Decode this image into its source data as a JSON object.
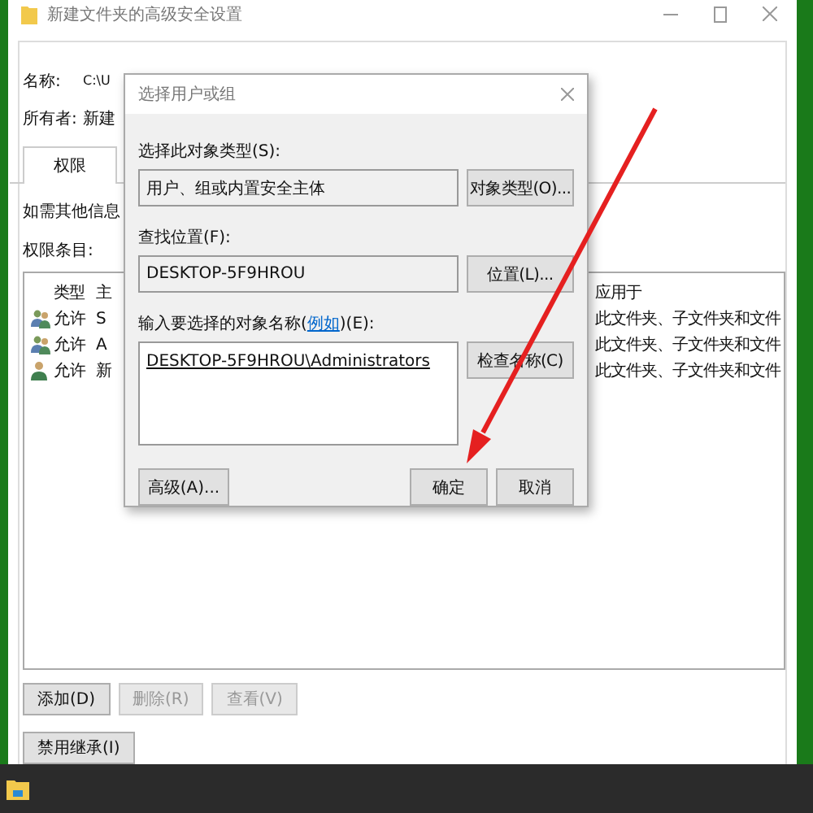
{
  "window": {
    "title": "新建文件夹的高级安全设置"
  },
  "fields": [
    {
      "label": "名称:",
      "value": "C:\\U"
    },
    {
      "label": "所有者:",
      "value": "新建"
    }
  ],
  "tabs": [
    {
      "label": "权限",
      "selected": true
    }
  ],
  "info_text": "如需其他信息",
  "entries_label": "权限条目:",
  "table": {
    "columns": [
      "类型",
      "主",
      "应用于"
    ],
    "rows": [
      {
        "kind": "group",
        "type": "允许",
        "principal": "S",
        "applies_to": "此文件夹、子文件夹和文件"
      },
      {
        "kind": "group",
        "type": "允许",
        "principal": "A",
        "applies_to": "此文件夹、子文件夹和文件"
      },
      {
        "kind": "user",
        "type": "允许",
        "principal": "新",
        "applies_to": "此文件夹、子文件夹和文件"
      }
    ]
  },
  "buttons": [
    {
      "label": "添加(D)",
      "disabled": false
    },
    {
      "label": "删除(R)",
      "disabled": true
    },
    {
      "label": "查看(V)",
      "disabled": true
    }
  ],
  "inherit_button": "禁用继承(I)",
  "dialog": {
    "title": "选择用户或组",
    "object_type": {
      "label": "选择此对象类型(S):",
      "value": "用户、组或内置安全主体",
      "button": "对象类型(O)..."
    },
    "location": {
      "label": "查找位置(F):",
      "value": "DESKTOP-5F9HROU",
      "button": "位置(L)..."
    },
    "names": {
      "label_before": "输入要选择的对象名称(",
      "link": "例如",
      "label_after": ")(E):",
      "value": "DESKTOP-5F9HROU\\Administrators",
      "button": "检查名称(C)"
    },
    "advanced_button": "高级(A)...",
    "ok_button": "确定",
    "cancel_button": "取消"
  }
}
